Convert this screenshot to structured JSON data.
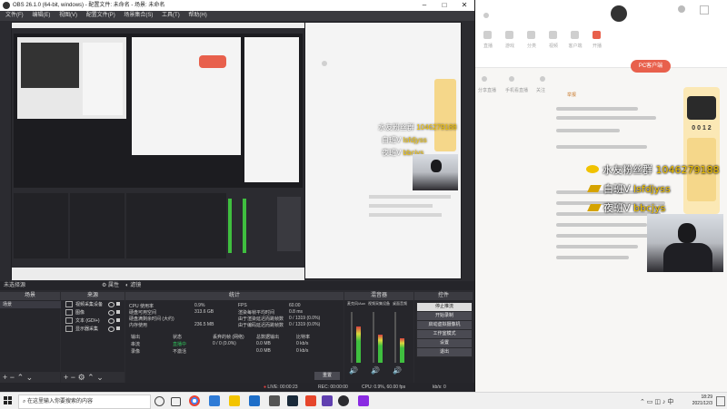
{
  "obs": {
    "title": "OBS 26.1.0 (64-bit, windows) - 配置文件: 未命名 - 场景: 未命名",
    "menu": [
      "文件(F)",
      "编辑(E)",
      "视图(V)",
      "配置文件(P)",
      "场景集合(S)",
      "工具(T)",
      "帮助(H)"
    ],
    "status_left": "未选择源",
    "status_btn1": "属性",
    "status_btn2": "滤镜"
  },
  "docks": {
    "scenes": "场景",
    "sources": "来源",
    "stats": "统计",
    "mixer": "混音器",
    "controls": "控件",
    "scene_item": "场景",
    "source_items": [
      "视频采集设备",
      "图像",
      "文本 (GDI+)",
      "显示器采集"
    ],
    "reset": "重置"
  },
  "stats": {
    "cpu_label": "CPU 使用率",
    "cpu_value": "0.9%",
    "disk_label": "硬盘可用空间",
    "disk_value": "313.6 GB",
    "disk_full_label": "硬盘满剩余时间 (大约)",
    "disk_full_value": "",
    "mem_label": "内存使用",
    "mem_value": "236.5 MB",
    "fps_label": "FPS",
    "fps_value": "60.00",
    "render_label": "渲染每帧平均时间",
    "render_value": "0.8 ms",
    "skip_render_label": "由于渲染延迟而跳帧数",
    "skip_render_value": "0 / 1319 (0.0%)",
    "skip_enc_label": "由于编码延迟而跳帧数",
    "skip_enc_value": "0 / 1319 (0.0%)",
    "headers": [
      "输出",
      "状态",
      "丢弃的帧 (网络)",
      "总数据输出",
      "比特率"
    ],
    "rows": [
      [
        "串流",
        "直播中",
        "0 / 0 (0.0%)",
        "0.0 MB",
        "0 kb/s"
      ],
      [
        "录像",
        "不激活",
        "",
        "0.0 MB",
        "0 kb/s"
      ]
    ]
  },
  "mixer": {
    "ch1": "麦克风/Aux",
    "ch2": "视频采集设备",
    "ch3": "桌面音频",
    "levels": [
      0.72,
      0.55,
      0.48
    ]
  },
  "controls": [
    "停止推流",
    "开始录制",
    "启动虚拟摄像机",
    "工作室模式",
    "设置",
    "退出"
  ],
  "obs_status": {
    "live": "LIVE: 00:00:23",
    "rec": "REC: 00:00:00",
    "cpu": "CPU: 0.9%, 60.00 fps",
    "drop": "kb/s: 0"
  },
  "stream_page": {
    "top_labels": [
      "直播",
      "游戏",
      "分类",
      "视频",
      "客户端",
      "开播",
      "我的"
    ],
    "row_labels": [
      "分享直播",
      "手机看直播",
      "关注",
      "举报"
    ],
    "pc_button": "PC客户端",
    "rank_score": "0 0 1 2",
    "gifts": [
      {
        "icon": "diamond-icon",
        "user": "水友粉丝群",
        "value": "1046279188"
      },
      {
        "icon": "badge-icon",
        "user": "白班V",
        "value": "lsfdjyss"
      },
      {
        "icon": "badge-icon",
        "user": "夜班V",
        "value": "bbcjys"
      }
    ],
    "nested_gifts": [
      {
        "user": "水友粉丝群",
        "value": "1046279188"
      },
      {
        "user": "白班V",
        "value": "lsfdjyss"
      },
      {
        "user": "夜班V",
        "value": "bbcjys"
      }
    ]
  },
  "taskbar": {
    "search_placeholder": "在这里输入你要搜索的内容",
    "time": "18:29",
    "date": "2021/12/3"
  }
}
